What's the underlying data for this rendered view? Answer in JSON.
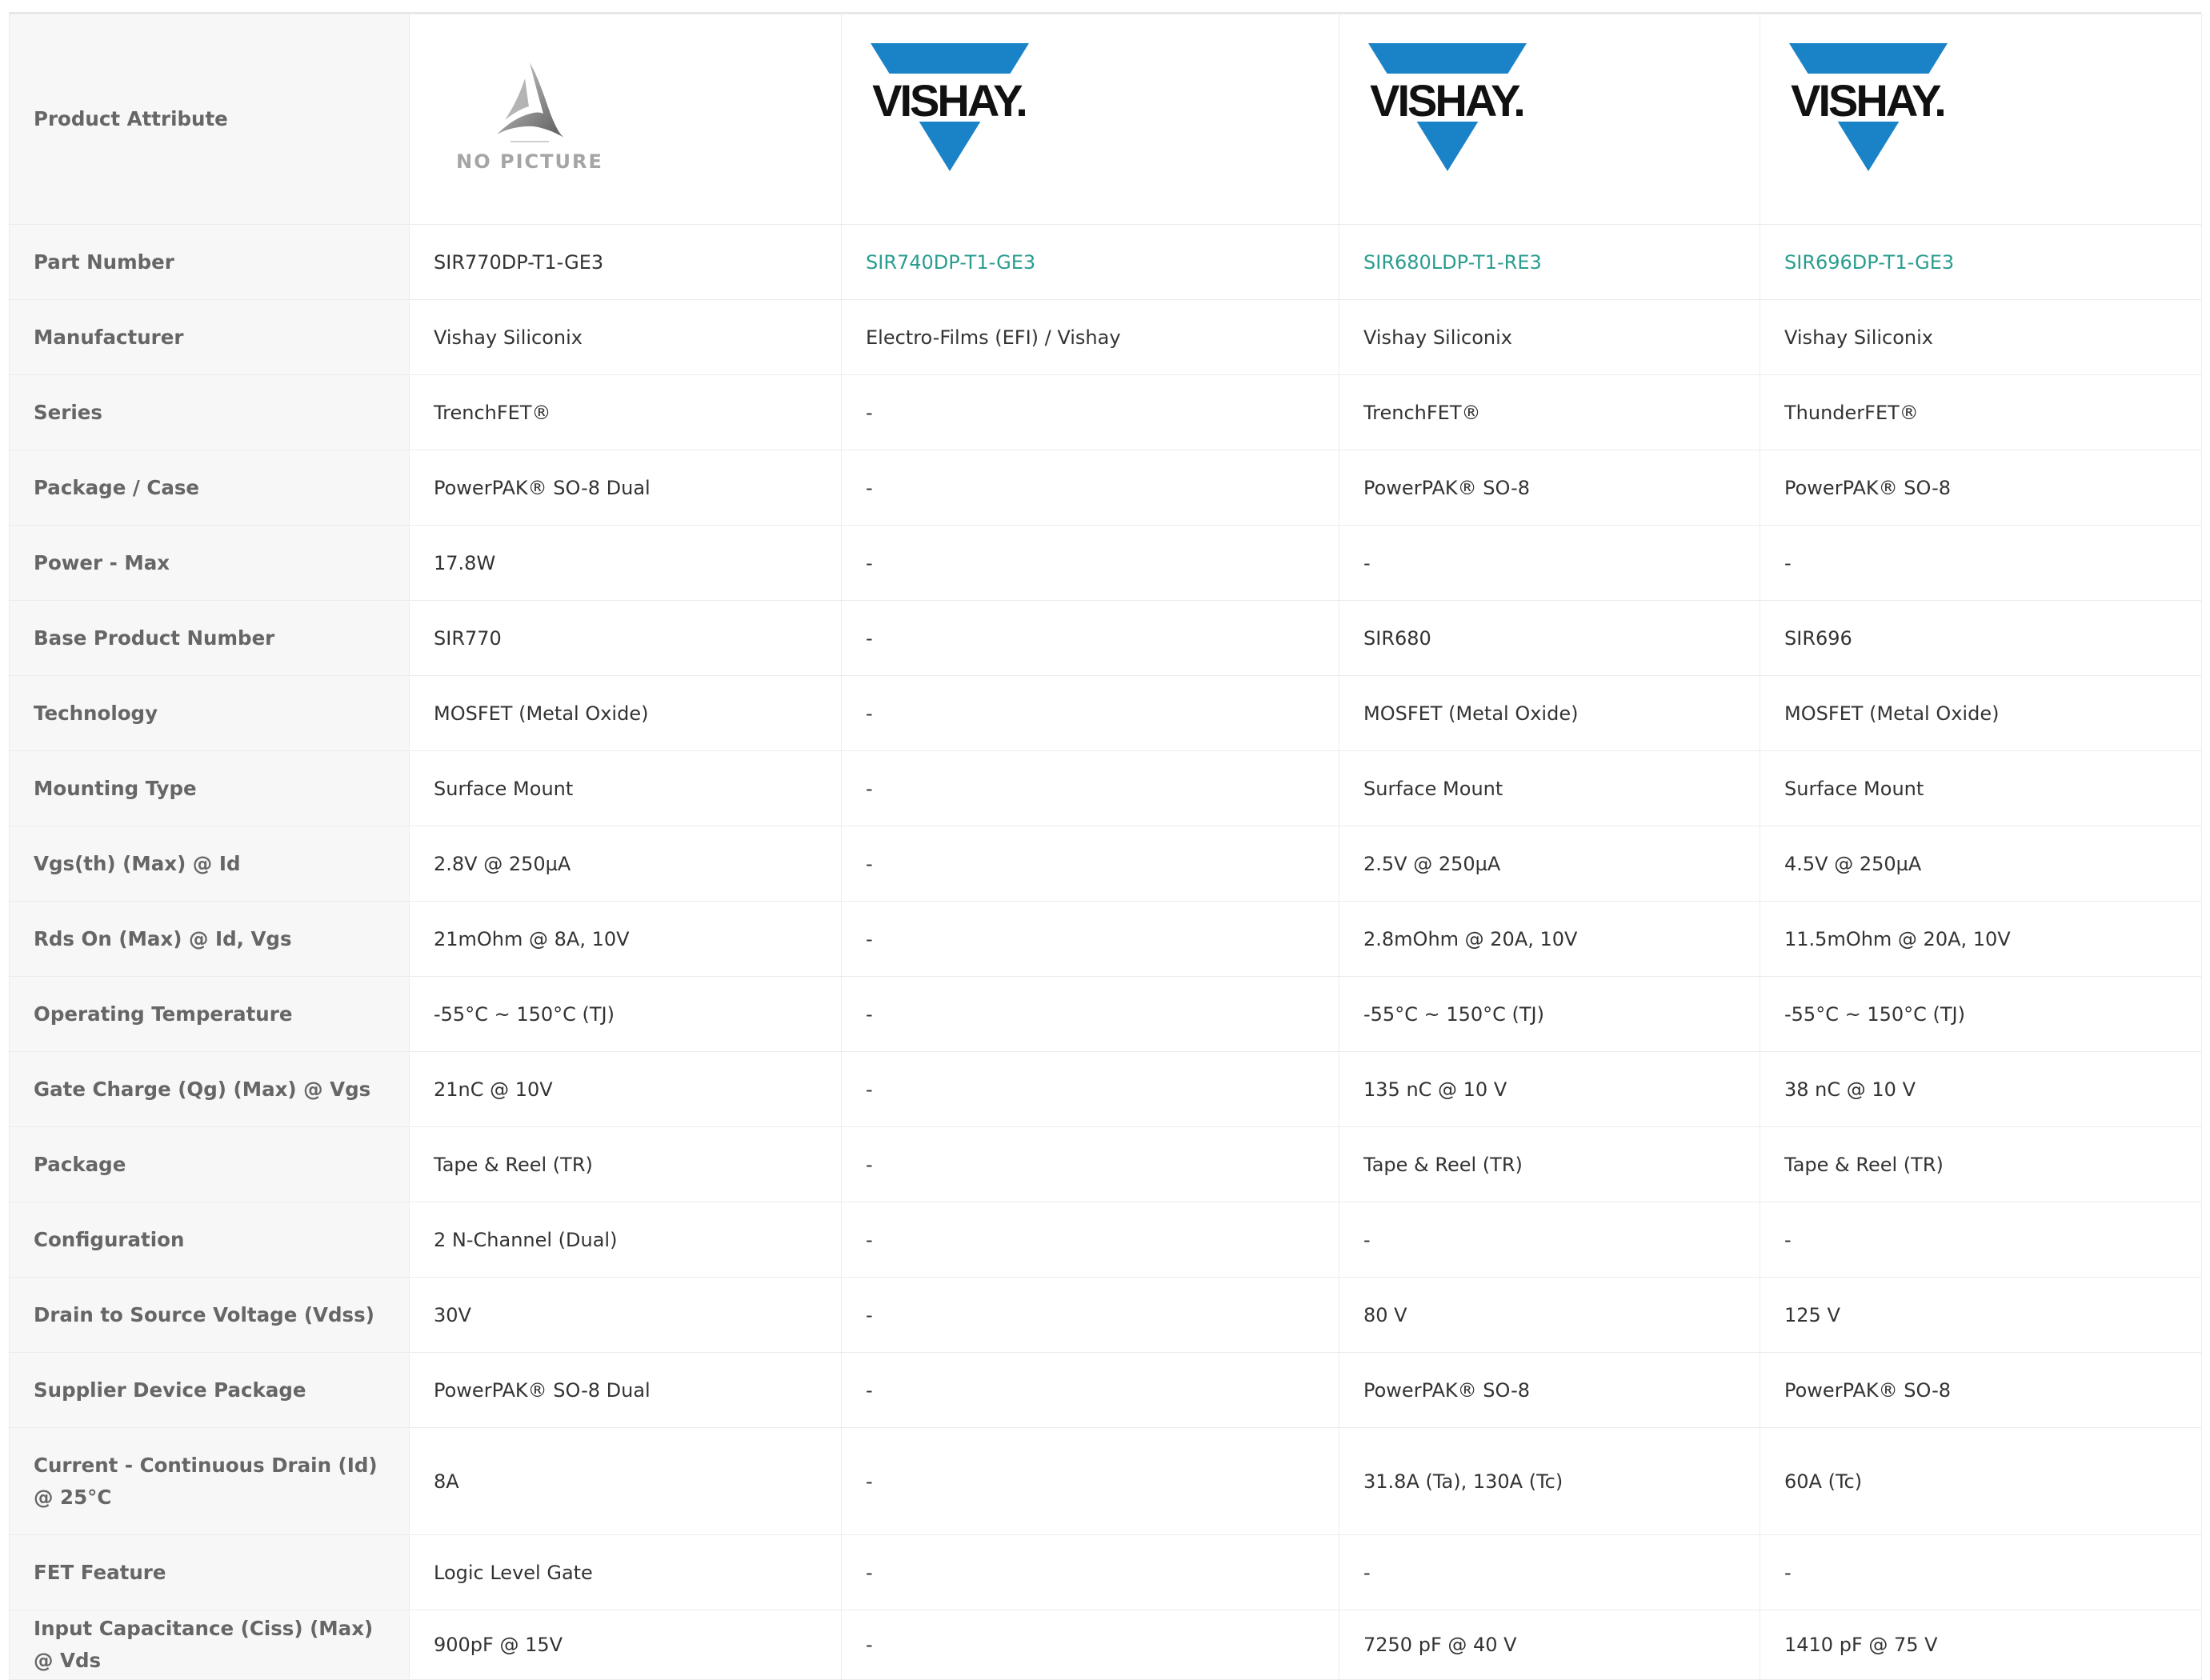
{
  "header": {
    "attribute_label": "Product Attribute",
    "no_picture_label": "NO PICTURE",
    "logo_text": "VISHAY."
  },
  "colors": {
    "link": "#2a9d8f",
    "vishay_blue": "#1a83c8",
    "attr_bg": "#f7f7f7"
  },
  "columns": [
    {
      "image": "no-picture-icon"
    },
    {
      "image": "vishay-logo"
    },
    {
      "image": "vishay-logo"
    },
    {
      "image": "vishay-logo"
    }
  ],
  "rows": [
    {
      "label": "Part Number",
      "values": [
        "SIR770DP-T1-GE3",
        "SIR740DP-T1-GE3",
        "SIR680LDP-T1-RE3",
        "SIR696DP-T1-GE3"
      ]
    },
    {
      "label": "Manufacturer",
      "values": [
        "Vishay Siliconix",
        "Electro-Films (EFI) / Vishay",
        "Vishay Siliconix",
        "Vishay Siliconix"
      ]
    },
    {
      "label": "Series",
      "values": [
        "TrenchFET®",
        "-",
        "TrenchFET®",
        "ThunderFET®"
      ]
    },
    {
      "label": "Package / Case",
      "values": [
        "PowerPAK® SO-8 Dual",
        "-",
        "PowerPAK® SO-8",
        "PowerPAK® SO-8"
      ]
    },
    {
      "label": "Power - Max",
      "values": [
        "17.8W",
        "-",
        "-",
        "-"
      ]
    },
    {
      "label": "Base Product Number",
      "values": [
        "SIR770",
        "-",
        "SIR680",
        "SIR696"
      ]
    },
    {
      "label": "Technology",
      "values": [
        "MOSFET (Metal Oxide)",
        "-",
        "MOSFET (Metal Oxide)",
        "MOSFET (Metal Oxide)"
      ]
    },
    {
      "label": "Mounting Type",
      "values": [
        "Surface Mount",
        "-",
        "Surface Mount",
        "Surface Mount"
      ]
    },
    {
      "label": "Vgs(th) (Max) @ Id",
      "values": [
        "2.8V @ 250µA",
        "-",
        "2.5V @ 250µA",
        "4.5V @ 250µA"
      ]
    },
    {
      "label": "Rds On (Max) @ Id, Vgs",
      "values": [
        "21mOhm @ 8A, 10V",
        "-",
        "2.8mOhm @ 20A, 10V",
        "11.5mOhm @ 20A, 10V"
      ]
    },
    {
      "label": "Operating Temperature",
      "values": [
        "-55°C ~ 150°C (TJ)",
        "-",
        "-55°C ~ 150°C (TJ)",
        "-55°C ~ 150°C (TJ)"
      ]
    },
    {
      "label": "Gate Charge (Qg) (Max) @ Vgs",
      "values": [
        "21nC @ 10V",
        "-",
        "135 nC @ 10 V",
        "38 nC @ 10 V"
      ]
    },
    {
      "label": "Package",
      "values": [
        "Tape & Reel (TR)",
        "-",
        "Tape & Reel (TR)",
        "Tape & Reel (TR)"
      ]
    },
    {
      "label": "Configuration",
      "values": [
        "2 N-Channel (Dual)",
        "-",
        "-",
        "-"
      ]
    },
    {
      "label": "Drain to Source Voltage (Vdss)",
      "values": [
        "30V",
        "-",
        "80 V",
        "125 V"
      ]
    },
    {
      "label": "Supplier Device Package",
      "values": [
        "PowerPAK® SO-8 Dual",
        "-",
        "PowerPAK® SO-8",
        "PowerPAK® SO-8"
      ]
    },
    {
      "label": "Current - Continuous Drain (Id) @ 25°C",
      "values": [
        "8A",
        "-",
        "31.8A (Ta), 130A (Tc)",
        "60A (Tc)"
      ]
    },
    {
      "label": "FET Feature",
      "values": [
        "Logic Level Gate",
        "-",
        "-",
        "-"
      ]
    },
    {
      "label": "Input Capacitance (Ciss) (Max) @ Vds",
      "values": [
        "900pF @ 15V",
        "-",
        "7250 pF @ 40 V",
        "1410 pF @ 75 V"
      ]
    }
  ]
}
